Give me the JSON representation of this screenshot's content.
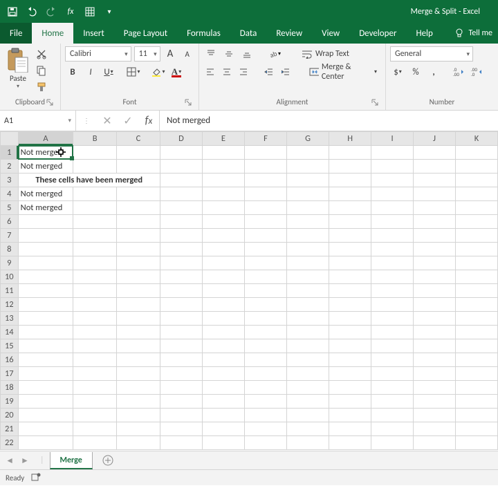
{
  "title": "Merge & Split  -  Excel",
  "tabs": {
    "file": "File",
    "home": "Home",
    "insert": "Insert",
    "page_layout": "Page Layout",
    "formulas": "Formulas",
    "data": "Data",
    "review": "Review",
    "view": "View",
    "developer": "Developer",
    "help": "Help",
    "tell_me": "Tell me"
  },
  "ribbon": {
    "clipboard": {
      "paste": "Paste",
      "label": "Clipboard"
    },
    "font": {
      "name": "Calibri",
      "size": "11",
      "grow": "A",
      "shrink": "A",
      "bold": "B",
      "italic": "I",
      "underline": "U",
      "label": "Font"
    },
    "alignment": {
      "wrap": "Wrap Text",
      "merge": "Merge & Center",
      "label": "Alignment"
    },
    "number": {
      "format": "General",
      "currency": "$",
      "percent": "%",
      "comma": ",",
      "label": "Number"
    }
  },
  "fbar": {
    "namebox": "A1",
    "formula": "Not merged"
  },
  "grid": {
    "cols": [
      "A",
      "B",
      "C",
      "D",
      "E",
      "F",
      "G",
      "H",
      "I",
      "J",
      "K"
    ],
    "rows": [
      "1",
      "2",
      "3",
      "4",
      "5",
      "6",
      "7",
      "8",
      "9",
      "10",
      "11",
      "12",
      "13",
      "14",
      "15",
      "16",
      "17",
      "18",
      "19",
      "20",
      "21",
      "22"
    ],
    "a1": "Not merged",
    "a2": "Not merged",
    "merged3": "These cells have been merged",
    "a4": "Not merged",
    "a5": "Not merged"
  },
  "sheettab": "Merge",
  "status": "Ready"
}
